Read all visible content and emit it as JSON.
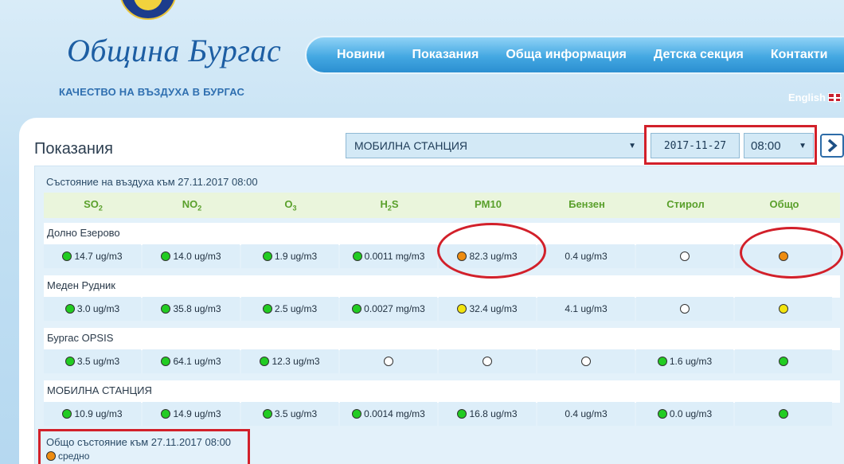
{
  "header": {
    "logo_text": "Община Бургас",
    "tagline": "КАЧЕСТВО НА ВЪЗДУХА В БУРГАС",
    "language_link": "English"
  },
  "nav": [
    {
      "label": "Новини"
    },
    {
      "label": "Показания"
    },
    {
      "label": "Обща информация"
    },
    {
      "label": "Детска секция"
    },
    {
      "label": "Контакти"
    }
  ],
  "main": {
    "page_title": "Показания",
    "station_select_value": "МОБИЛНА СТАНЦИЯ",
    "date_value": "2017-11-27",
    "time_value": "08:00",
    "state_title": "Състояние на въздуха към 27.11.2017 08:00"
  },
  "pollutants": [
    {
      "base": "SO",
      "sub": "2"
    },
    {
      "base": "NO",
      "sub": "2"
    },
    {
      "base": "O",
      "sub": "3"
    },
    {
      "base": "H",
      "sub": "2",
      "suffix": "S"
    },
    {
      "base": "PM10",
      "sub": ""
    },
    {
      "base": "Бензен",
      "sub": ""
    },
    {
      "base": "Стирол",
      "sub": ""
    },
    {
      "base": "Общо",
      "sub": ""
    }
  ],
  "stations": [
    {
      "name": "Долно Езерово",
      "cells": [
        {
          "status": "green",
          "value": "14.7 ug/m3"
        },
        {
          "status": "green",
          "value": "14.0 ug/m3"
        },
        {
          "status": "green",
          "value": "1.9 ug/m3"
        },
        {
          "status": "green",
          "value": "0.0011 mg/m3"
        },
        {
          "status": "orange",
          "value": "82.3 ug/m3"
        },
        {
          "status": "",
          "value": "0.4 ug/m3"
        },
        {
          "status": "white",
          "value": ""
        },
        {
          "status": "orange",
          "value": ""
        }
      ]
    },
    {
      "name": "Меден Рудник",
      "cells": [
        {
          "status": "green",
          "value": "3.0 ug/m3"
        },
        {
          "status": "green",
          "value": "35.8 ug/m3"
        },
        {
          "status": "green",
          "value": "2.5 ug/m3"
        },
        {
          "status": "green",
          "value": "0.0027 mg/m3"
        },
        {
          "status": "yellow",
          "value": "32.4 ug/m3"
        },
        {
          "status": "",
          "value": "4.1 ug/m3"
        },
        {
          "status": "white",
          "value": ""
        },
        {
          "status": "yellow",
          "value": ""
        }
      ]
    },
    {
      "name": "Бургас OPSIS",
      "cells": [
        {
          "status": "green",
          "value": "3.5 ug/m3"
        },
        {
          "status": "green",
          "value": "64.1 ug/m3"
        },
        {
          "status": "green",
          "value": "12.3 ug/m3"
        },
        {
          "status": "white",
          "value": ""
        },
        {
          "status": "white",
          "value": ""
        },
        {
          "status": "white",
          "value": ""
        },
        {
          "status": "green",
          "value": "1.6 ug/m3"
        },
        {
          "status": "green",
          "value": ""
        }
      ]
    },
    {
      "name": "МОБИЛНА СТАНЦИЯ",
      "cells": [
        {
          "status": "green",
          "value": "10.9 ug/m3"
        },
        {
          "status": "green",
          "value": "14.9 ug/m3"
        },
        {
          "status": "green",
          "value": "3.5 ug/m3"
        },
        {
          "status": "green",
          "value": "0.0014 mg/m3"
        },
        {
          "status": "green",
          "value": "16.8 ug/m3"
        },
        {
          "status": "",
          "value": "0.4 ug/m3"
        },
        {
          "status": "green",
          "value": "0.0 ug/m3"
        },
        {
          "status": "green",
          "value": ""
        }
      ]
    }
  ],
  "overall": {
    "title": "Общо състояние към 27.11.2017 08:00",
    "status": "orange",
    "label": "средно"
  },
  "colors": {
    "nav": "#44a8e2",
    "highlight": "#d2202a",
    "status_green": "#22cc22",
    "status_orange": "#ee8c10",
    "status_yellow": "#f2e40e"
  },
  "icons": {
    "next": "chevron-right-icon",
    "flag": "uk-flag-icon"
  }
}
